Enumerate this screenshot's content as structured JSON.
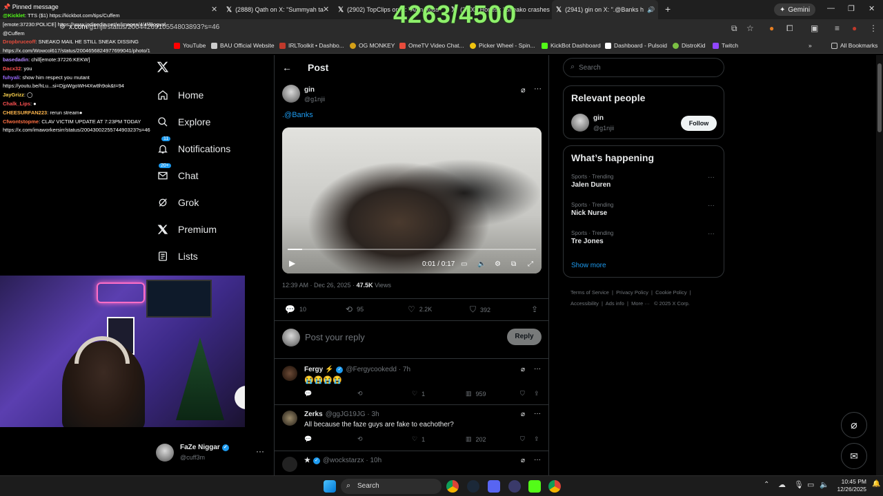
{
  "browser": {
    "tabs": [
      {
        "label": "(2888) Qath on X: \"Summyah ta",
        "active": false
      },
      {
        "label": "(2902) TopClips on X: \"Adin Ross",
        "active": false
      },
      {
        "label": "(2900) Honest: \"Sneako crashes ou",
        "active": false
      },
      {
        "label": "(2941) gin on X: \".@Banks h",
        "active": true
      }
    ],
    "gemini_label": "Gemini",
    "url_host": "x.com",
    "url_path": "/g1njii/status/2004426910554803893?s=46",
    "all_bookmarks_label": "All Bookmarks",
    "bookmarks": [
      {
        "label": "YouTube",
        "color": "#ff0000"
      },
      {
        "label": "BAU Official Website",
        "color": "#cccccc"
      },
      {
        "label": "IRLToolkit • Dashbo...",
        "color": "#c0392b"
      },
      {
        "label": "OG MONKEY",
        "color": "#d4a017"
      },
      {
        "label": "OmeTV Video Chat...",
        "color": "#e74c3c"
      },
      {
        "label": "Picker Wheel - Spin...",
        "color": "#f1c40f"
      },
      {
        "label": "KickBot Dashboard",
        "color": "#53fc18"
      },
      {
        "label": "Dashboard - Pulsoid",
        "color": "#ffffff"
      },
      {
        "label": "DistroKid",
        "color": "#7bc043"
      },
      {
        "label": "Twitch",
        "color": "#9146ff"
      }
    ]
  },
  "overlay": {
    "counter": "4263/4500",
    "pinned_label": "Pinned message",
    "chat": [
      {
        "user": "@Kicklet",
        "text": ": TTS ($1) https://kickbot.com/tips/Cuffem",
        "color": "#53fc18"
      },
      {
        "user": "",
        "text": "[emote:37230:POLICE] https://www.jodipedia.net/w/images/4/4f/Bogusb8...",
        "color": "#ffffff"
      },
      {
        "user": "",
        "text": "@Cuffem",
        "color": "#ffffff"
      },
      {
        "user": "Dropbruceoff",
        "text": ": SNEAKO MAIL HE STILL SNEAK DISSING https://x.com/Wowcol617/status/2004656824977699041/photo/1",
        "color": "#e74c3c"
      },
      {
        "user": "basedadin",
        "text": ": chill[emote:37226:KEKW]",
        "color": "#b388ff"
      },
      {
        "user": "Dacx32",
        "text": ": you",
        "color": "#ff5252"
      },
      {
        "user": "fuhyali",
        "text": ": show him respect you mutant https://youtu.be/hLu...si=DjpWgoWH4Xw8h9ok&t=94",
        "color": "#9c6bff"
      },
      {
        "user": "JayGrizz",
        "text": ": ◯",
        "color": "#ffd54f"
      },
      {
        "user": "Chalk_Lips",
        "text": ": ●",
        "color": "#ff5252"
      },
      {
        "user": "CHEESURFAN223",
        "text": ": rerun stream●",
        "color": "#ffb74d"
      },
      {
        "user": "Cfwontstopme",
        "text": ": CLAV VICTIM UPDATE AT 7:23PM TODAY https://x.com/imaworkersirr/status/2004300225574490323?s=46",
        "color": "#ff7043"
      }
    ]
  },
  "nav": {
    "items": [
      {
        "label": "Home",
        "icon": "home-icon"
      },
      {
        "label": "Explore",
        "icon": "search-icon"
      },
      {
        "label": "Notifications",
        "icon": "bell-icon",
        "badge": "11"
      },
      {
        "label": "Chat",
        "icon": "mail-icon",
        "badge": "20+"
      },
      {
        "label": "Grok",
        "icon": "grok-icon"
      },
      {
        "label": "Premium",
        "icon": "x-icon"
      },
      {
        "label": "Lists",
        "icon": "list-icon"
      }
    ],
    "account": {
      "name": "FaZe Niggar",
      "handle": "@cuff3m"
    }
  },
  "post": {
    "header": "Post",
    "author_name": "gin",
    "author_handle": "@g1njii",
    "text": ".@Banks",
    "video_time": "0:01 / 0:17",
    "timestamp": "12:39 AM · Dec 26, 2025 · ",
    "views_count": "47.5K",
    "views_label": " Views",
    "stats": {
      "replies": "10",
      "reposts": "95",
      "likes": "2.2K",
      "bookmarks": "392"
    },
    "reply_placeholder": "Post your reply",
    "reply_button": "Reply"
  },
  "replies": [
    {
      "name": "Fergy ⚡",
      "handle": "@Fergycookedd · 7h",
      "text": "😭😭😭😭",
      "reply": "",
      "repost": "",
      "like": "1",
      "views": "959"
    },
    {
      "name": "Zerks",
      "handle": "@ggJG19JG · 3h",
      "text": "All because the faze guys are fake to eachother?",
      "reply": "",
      "repost": "",
      "like": "1",
      "views": "202"
    },
    {
      "name": "★",
      "handle": "@wockstarzx · 10h",
      "text": "",
      "reply": "",
      "repost": "",
      "like": "",
      "views": ""
    }
  ],
  "sidebar": {
    "search_placeholder": "Search",
    "relevant_title": "Relevant people",
    "relevant_name": "gin",
    "relevant_handle": "@g1njii",
    "follow_label": "Follow",
    "happening_title": "What’s happening",
    "trends": [
      {
        "category": "Sports · Trending",
        "name": "Jalen Duren"
      },
      {
        "category": "Sports · Trending",
        "name": "Nick Nurse"
      },
      {
        "category": "Sports · Trending",
        "name": "Tre Jones"
      }
    ],
    "show_more": "Show more",
    "footer": [
      "Terms of Service",
      "Privacy Policy",
      "Cookie Policy",
      "Accessibility",
      "Ads info",
      "More ···",
      "© 2025 X Corp."
    ]
  },
  "taskbar": {
    "search_label": "Search",
    "time": "10:45 PM",
    "date": "12/26/2025"
  }
}
